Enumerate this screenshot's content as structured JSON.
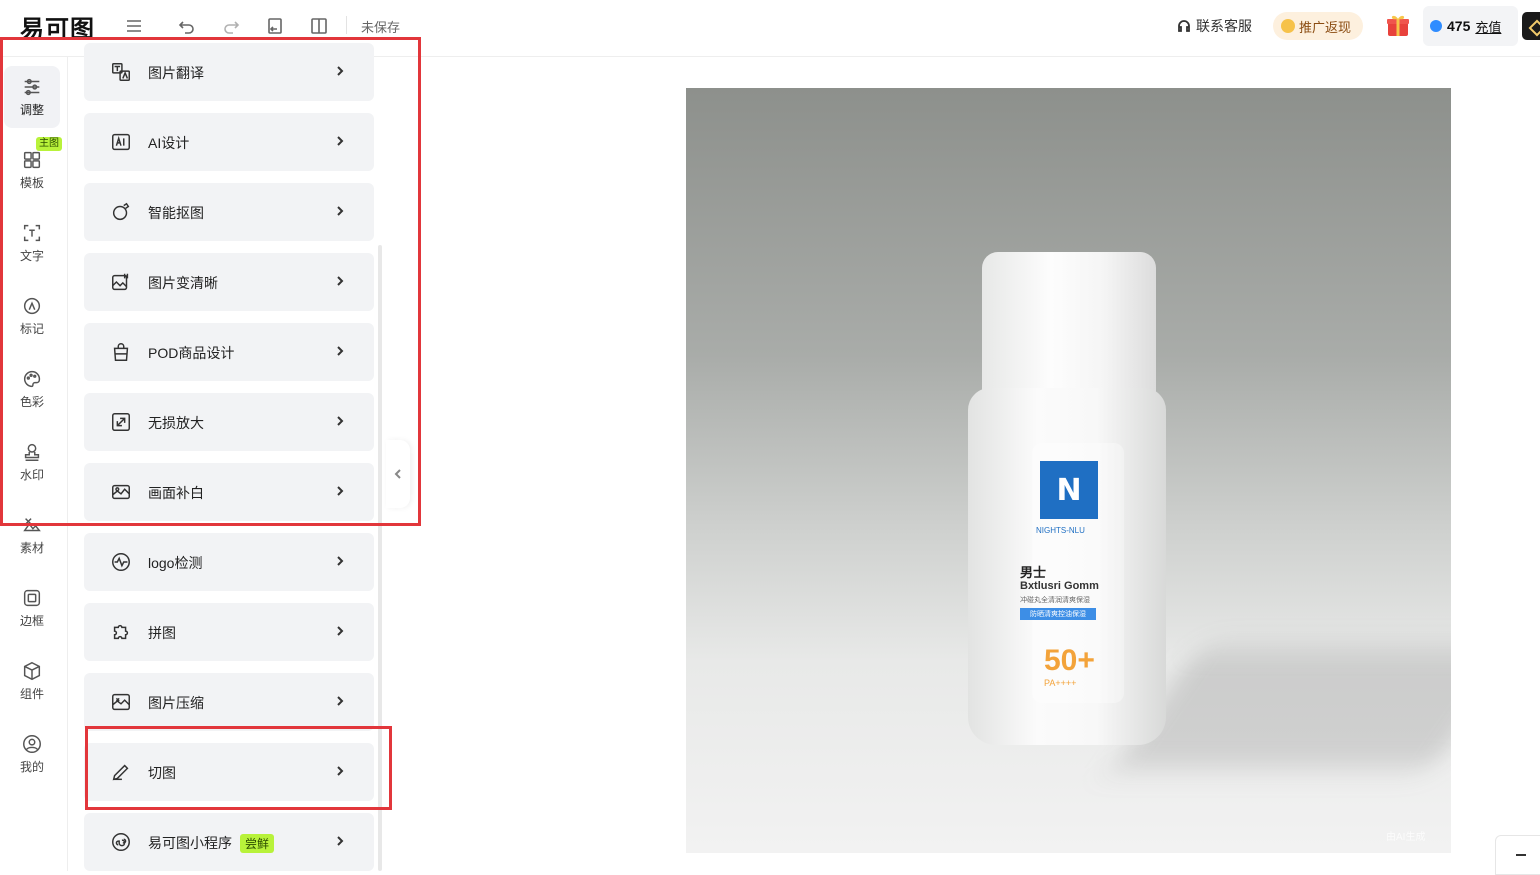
{
  "header": {
    "logo": "易可图",
    "save_status": "未保存",
    "support_label": "联系客服",
    "promo_label": "推广返现",
    "balance": "475",
    "recharge_label": "充值"
  },
  "rail": {
    "badge": "主图",
    "items": [
      {
        "label": "调整",
        "icon": "sliders-icon"
      },
      {
        "label": "模板",
        "icon": "grid-icon"
      },
      {
        "label": "文字",
        "icon": "text-icon"
      },
      {
        "label": "标记",
        "icon": "marker-icon"
      },
      {
        "label": "色彩",
        "icon": "palette-icon"
      },
      {
        "label": "水印",
        "icon": "stamp-icon"
      },
      {
        "label": "素材",
        "icon": "material-icon"
      },
      {
        "label": "边框",
        "icon": "frame-icon"
      },
      {
        "label": "组件",
        "icon": "box-icon"
      },
      {
        "label": "我的",
        "icon": "user-icon"
      }
    ]
  },
  "tools": [
    {
      "label": "图片翻译",
      "icon": "translate-icon"
    },
    {
      "label": "AI设计",
      "icon": "ai-icon"
    },
    {
      "label": "智能抠图",
      "icon": "cutout-icon"
    },
    {
      "label": "图片变清晰",
      "icon": "hd-icon"
    },
    {
      "label": "POD商品设计",
      "icon": "bag-icon"
    },
    {
      "label": "无损放大",
      "icon": "enlarge-icon"
    },
    {
      "label": "画面补白",
      "icon": "fill-icon"
    },
    {
      "label": "logo检测",
      "icon": "detect-icon"
    },
    {
      "label": "拼图",
      "icon": "puzzle-icon"
    },
    {
      "label": "图片压缩",
      "icon": "compress-icon"
    },
    {
      "label": "切图",
      "icon": "knife-icon"
    },
    {
      "label": "易可图小程序",
      "icon": "miniprogram-icon",
      "tag": "尝鲜"
    }
  ],
  "canvas": {
    "brand_mark": "N",
    "brand_name": "NIGHTS-NLU",
    "title": "男士",
    "subtitle": "Bxtlusri Gomm",
    "small_text": "冲碰丸全清润清爽保湿",
    "bar_text": "防晒清爽控油保湿",
    "spf": "50+",
    "spf_sub": "PA++++",
    "watermark": "由AI生成"
  }
}
